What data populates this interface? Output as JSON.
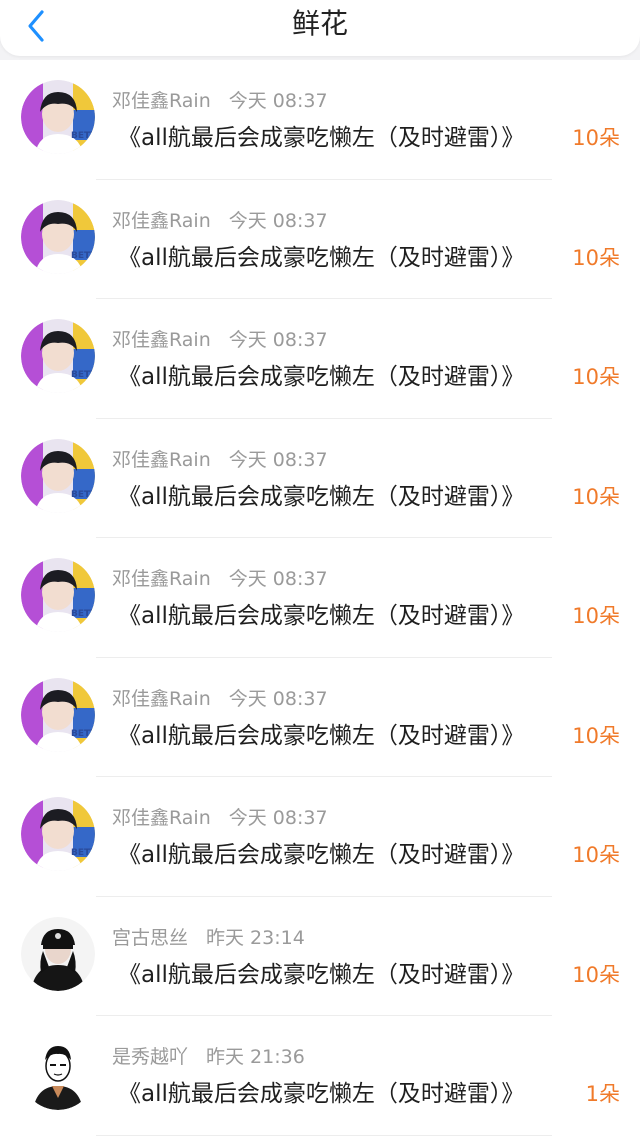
{
  "header": {
    "title": "鲜花",
    "back_icon": "chevron-left-icon",
    "accent": "#1e90ff"
  },
  "rows": [
    {
      "user": "邓佳鑫Rain",
      "time": "今天 08:37",
      "book": "《all航最后会成豪吃懒左（及时避雷）》",
      "count": "10朵",
      "avatar": "photo-avatar"
    },
    {
      "user": "邓佳鑫Rain",
      "time": "今天 08:37",
      "book": "《all航最后会成豪吃懒左（及时避雷）》",
      "count": "10朵",
      "avatar": "photo-avatar"
    },
    {
      "user": "邓佳鑫Rain",
      "time": "今天 08:37",
      "book": "《all航最后会成豪吃懒左（及时避雷）》",
      "count": "10朵",
      "avatar": "photo-avatar"
    },
    {
      "user": "邓佳鑫Rain",
      "time": "今天 08:37",
      "book": "《all航最后会成豪吃懒左（及时避雷）》",
      "count": "10朵",
      "avatar": "photo-avatar"
    },
    {
      "user": "邓佳鑫Rain",
      "time": "今天 08:37",
      "book": "《all航最后会成豪吃懒左（及时避雷）》",
      "count": "10朵",
      "avatar": "photo-avatar"
    },
    {
      "user": "邓佳鑫Rain",
      "time": "今天 08:37",
      "book": "《all航最后会成豪吃懒左（及时避雷）》",
      "count": "10朵",
      "avatar": "photo-avatar"
    },
    {
      "user": "邓佳鑫Rain",
      "time": "今天 08:37",
      "book": "《all航最后会成豪吃懒左（及时避雷）》",
      "count": "10朵",
      "avatar": "photo-avatar"
    },
    {
      "user": "宫古思丝",
      "time": "昨天 23:14",
      "book": "《all航最后会成豪吃懒左（及时避雷）》",
      "count": "10朵",
      "avatar": "cap-avatar"
    },
    {
      "user": "是秀越吖",
      "time": "昨天 21:36",
      "book": "《all航最后会成豪吃懒左（及时避雷）》",
      "count": "1朵",
      "avatar": "cartoon-avatar"
    }
  ],
  "colors": {
    "count": "#f07a2a",
    "meta": "#9a9a9a"
  }
}
